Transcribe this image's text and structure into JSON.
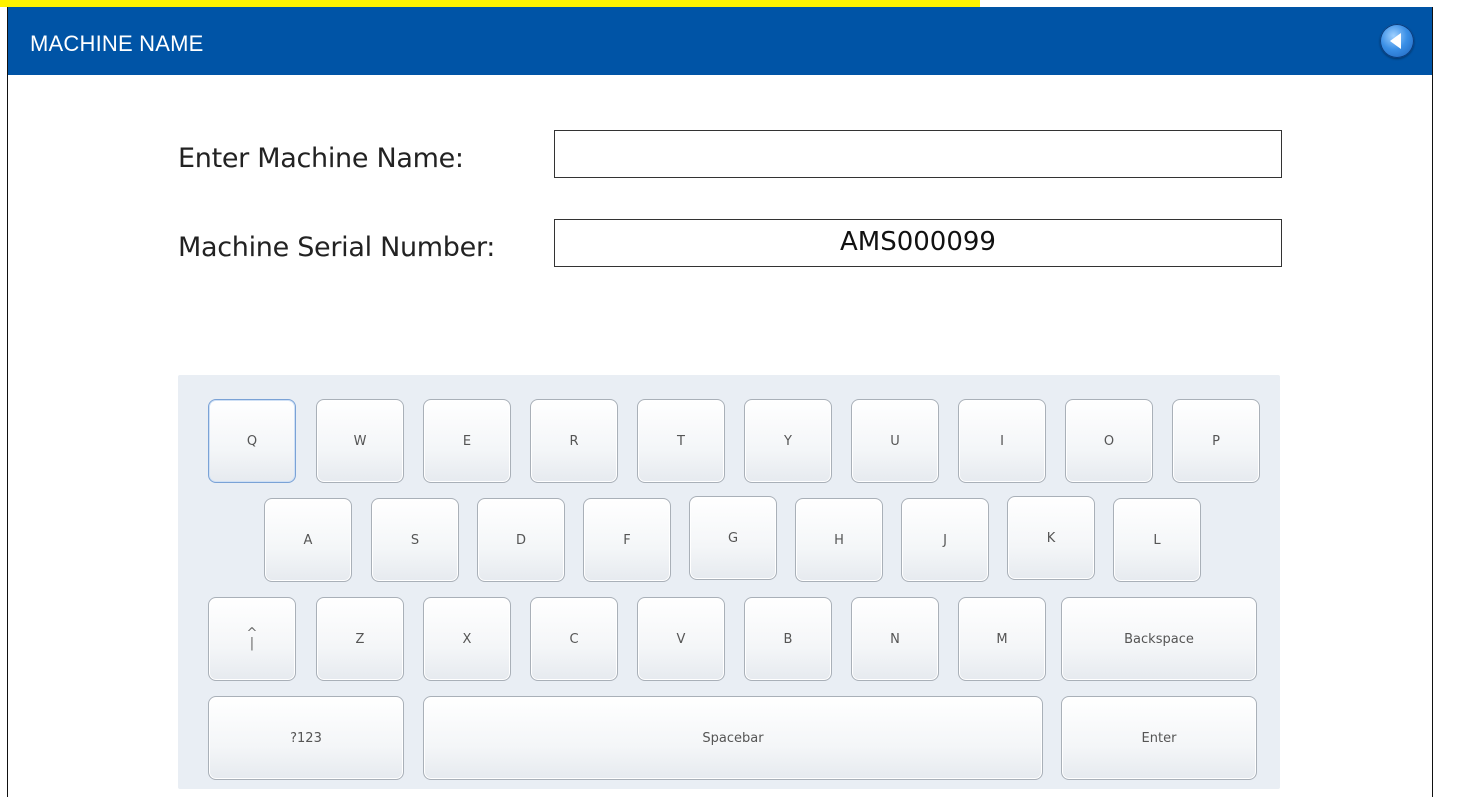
{
  "window": {
    "title": "MACHINE NAME"
  },
  "form": {
    "name_label": "Enter Machine Name:",
    "name_value": "",
    "serial_label": "Machine Serial Number:",
    "serial_value": "AMS000099"
  },
  "keyboard": {
    "row1": [
      "Q",
      "W",
      "E",
      "R",
      "T",
      "Y",
      "U",
      "I",
      "O",
      "P"
    ],
    "row2": [
      "A",
      "S",
      "D",
      "F",
      "G",
      "H",
      "J",
      "K",
      "L"
    ],
    "row3": [
      "Z",
      "X",
      "C",
      "V",
      "B",
      "N",
      "M"
    ],
    "shift_top": "^",
    "shift_bottom": "|",
    "backspace": "Backspace",
    "numbers": "?123",
    "spacebar": "Spacebar",
    "enter": "Enter"
  },
  "colors": {
    "header": "#0054a6",
    "highlight_strip": "#fff200"
  },
  "icons": {
    "back": "back-arrow-icon"
  }
}
